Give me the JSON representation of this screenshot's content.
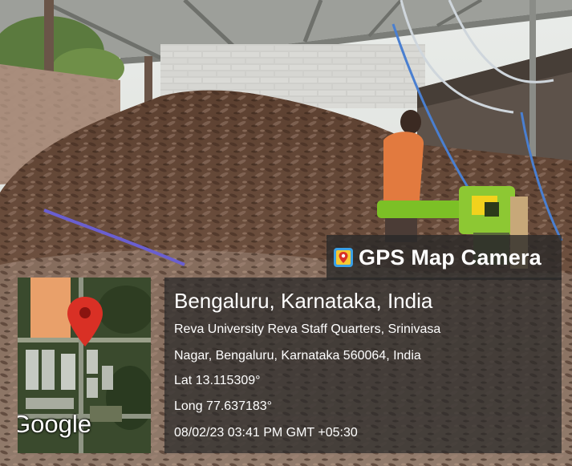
{
  "overlay": {
    "app_name": "GPS Map Camera",
    "map_brand": "Google",
    "location_title": "Bengaluru, Karnataka, India",
    "address_line1": "Reva University Reva Staff Quarters, Srinivasa",
    "address_line2": "Nagar, Bengaluru, Karnataka 560064, India",
    "latitude": "Lat 13.115309°",
    "longitude": "Long 77.637183°",
    "timestamp": "08/02/23 03:41 PM GMT +05:30"
  },
  "icons": [
    "map-pin-icon",
    "gps-camera-icon"
  ],
  "colors": {
    "pin_red": "#d93025",
    "overlay_bg": "#282828",
    "leaf_brown": "#6b4a33",
    "shirt_orange": "#e07a3c",
    "machine_green": "#7fbf2a"
  }
}
